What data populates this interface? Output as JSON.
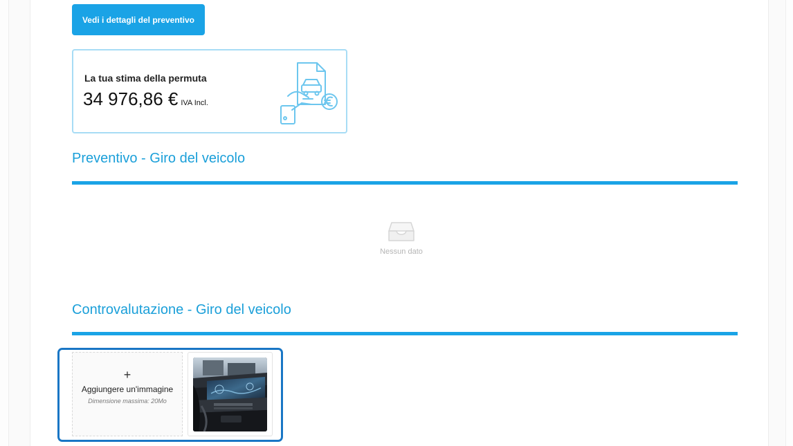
{
  "header": {
    "quote_button_label": "Vedi i dettagli del preventivo"
  },
  "estimate": {
    "label": "La tua stima della permuta",
    "amount": "34 976,86 €",
    "vat_note": "IVA Incl.",
    "icon": "car-document-euro-icon"
  },
  "sections": {
    "quote": {
      "title": "Preventivo - Giro del veicolo",
      "empty_text": "Nessun dato",
      "empty_icon": "empty-inbox-icon"
    },
    "counter_valuation": {
      "title": "Controvalutazione - Giro del veicolo",
      "upload_plus": "+",
      "upload_label": "Aggiungere un'immagine",
      "upload_hint": "Dimensione massima: 20Mo"
    }
  },
  "colors": {
    "accent": "#1aa3e6",
    "title_blue": "#1a9fd9",
    "card_border": "#a7dcf5",
    "focus_border": "#1976c5"
  }
}
